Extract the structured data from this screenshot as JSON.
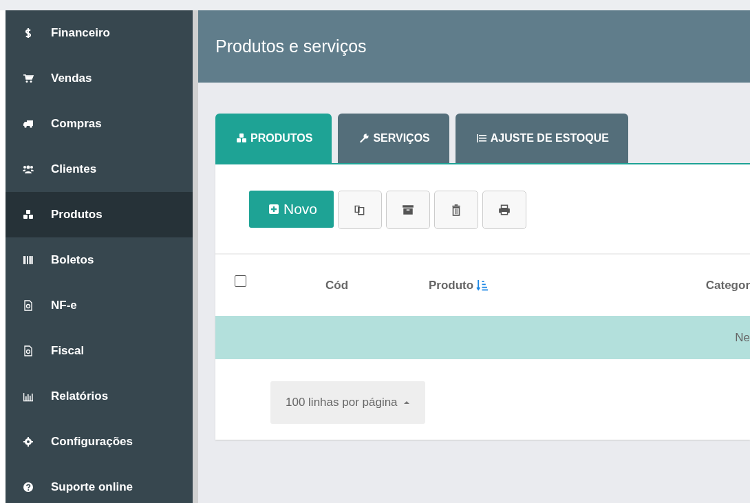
{
  "sidebar": {
    "items": [
      {
        "label": "Financeiro",
        "selected": false
      },
      {
        "label": "Vendas",
        "selected": false
      },
      {
        "label": "Compras",
        "selected": false
      },
      {
        "label": "Clientes",
        "selected": false
      },
      {
        "label": "Produtos",
        "selected": true
      },
      {
        "label": "Boletos",
        "selected": false
      },
      {
        "label": "NF-e",
        "selected": false
      },
      {
        "label": "Fiscal",
        "selected": false
      },
      {
        "label": "Relatórios",
        "selected": false
      },
      {
        "label": "Configurações",
        "selected": false
      },
      {
        "label": "Suporte online",
        "selected": false
      }
    ]
  },
  "header": {
    "title": "Produtos e serviços"
  },
  "tabs": [
    {
      "label": "PRODUTOS",
      "selected": true
    },
    {
      "label": "SERVIÇOS",
      "selected": false
    },
    {
      "label": "AJUSTE DE ESTOQUE",
      "selected": false
    }
  ],
  "toolbar": {
    "new_button": "Novo"
  },
  "table": {
    "select_all": {
      "checked": false
    },
    "columns": [
      {
        "label": "Cód",
        "sorted": false
      },
      {
        "label": "Produto",
        "sorted": true
      },
      {
        "label": "Categor",
        "sorted": false
      }
    ],
    "empty_row": "Ne"
  },
  "pagination": {
    "page_size": "100 linhas por página"
  }
}
